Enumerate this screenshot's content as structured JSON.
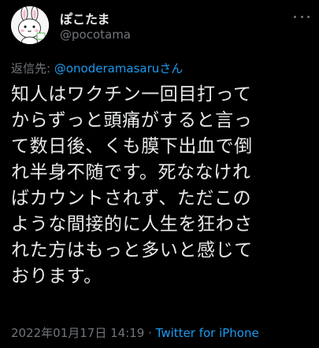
{
  "author": {
    "display_name": "ぽこたま",
    "handle": "@pocotama"
  },
  "reply": {
    "prefix": "返信先: ",
    "mention": "@onoderamasaruさん"
  },
  "tweet": {
    "lines": [
      "知人はワクチン一回目打って",
      "からずっと頭痛がすると言っ",
      "て数日後、くも膜下出血で倒",
      "れ半身不随です。死ななけれ",
      "ばカウントされず、ただこの",
      "ような間接的に人生を狂わさ",
      "れた方はもっと多いと感じて",
      "おります。"
    ]
  },
  "meta": {
    "timestamp": "2022年01月17日 14:19",
    "separator": " · ",
    "source": "Twitter for iPhone"
  },
  "icons": {
    "avatar": "bunny-character-avatar",
    "more": "more-options-icon"
  },
  "colors": {
    "background": "#000000",
    "text": "#e7e9ea",
    "secondary": "#71767b",
    "link": "#1d9bf0"
  }
}
